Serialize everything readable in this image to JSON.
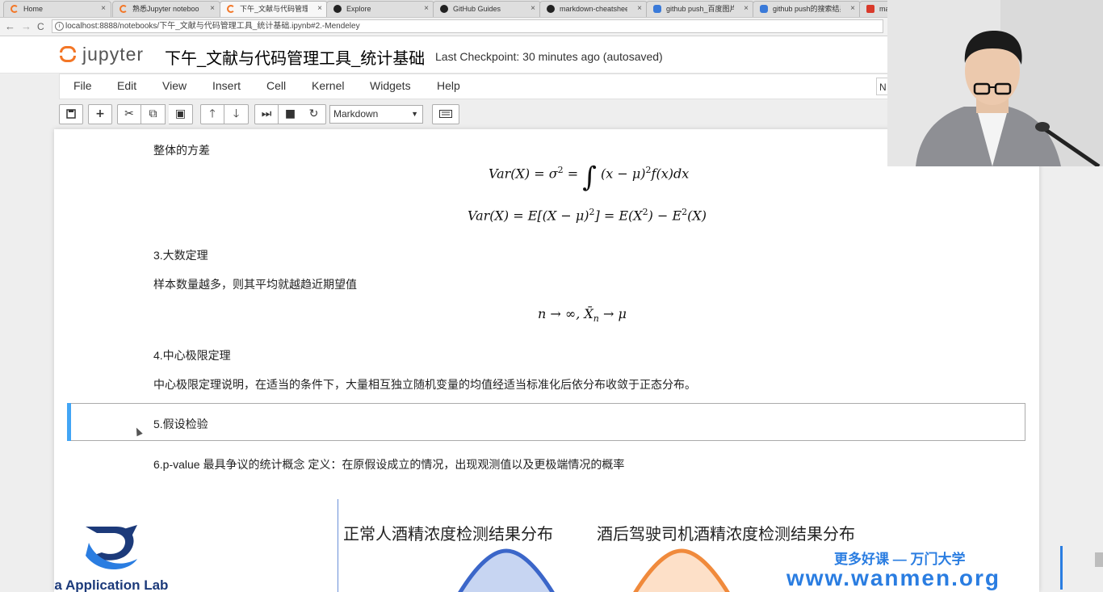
{
  "browser": {
    "tabs": [
      {
        "label": "Home",
        "icon": "jupyter"
      },
      {
        "label": "熟悉Jupyter noteboo",
        "icon": "jupyter"
      },
      {
        "label": "下午_文献与代码管理工",
        "icon": "jupyter",
        "active": true
      },
      {
        "label": "Explore",
        "icon": "github"
      },
      {
        "label": "GitHub Guides",
        "icon": "github"
      },
      {
        "label": "markdown-cheatshee",
        "icon": "github"
      },
      {
        "label": "github push_百度图片",
        "icon": "baidu"
      },
      {
        "label": "github push的搜索结果",
        "icon": "baidu"
      },
      {
        "label": "ma",
        "icon": "red"
      }
    ],
    "close_glyph": "×",
    "back_glyph": "←",
    "forward_glyph": "→",
    "reload_glyph": "C",
    "url": "localhost:8888/notebooks/下午_文献与代码管理工具_统计基础.ipynb#2.-Mendeley"
  },
  "jupyter": {
    "wordmark": "jupyter",
    "notebook_title": "下午_文献与代码管理工具_统计基础",
    "checkpoint": "Last Checkpoint: 30 minutes ago (autosaved)",
    "menu": [
      "File",
      "Edit",
      "View",
      "Insert",
      "Cell",
      "Kernel",
      "Widgets",
      "Help"
    ],
    "kernel_indicator": "N",
    "toolbar": {
      "save_icon": "save-icon",
      "add_icon": "plus-icon",
      "cell_type": "Markdown",
      "cell_type_arrow": "▼"
    }
  },
  "cells": {
    "variance_heading": "整体的方差",
    "var_eq1": {
      "lhs": "Var(X) = σ",
      "sup": "2",
      "mid": " = ",
      "integral": "∫",
      "rhs": " (x − μ)",
      "sup2": "2",
      "rhs2": "f(x)dx"
    },
    "var_eq2": {
      "lhs": "Var(X) = E[(X − μ)",
      "sup": "2",
      "mid": "] = E(X",
      "sup2": "2",
      "mid2": ") − E",
      "sup3": "2",
      "end": "(X)"
    },
    "lln_heading": "3.大数定理",
    "lln_text": "样本数量越多，则其平均就越趋近期望值",
    "lln_eq": {
      "a": "n → ∞, ",
      "xbar": "X̄",
      "sub": "n",
      "b": " → μ"
    },
    "clt_heading": "4.中心极限定理",
    "clt_text": "中心极限定理说明，在适当的条件下，大量相互独立随机变量的均值经适当标准化后依分布收敛于正态分布。",
    "hyp_heading": "5.假设检验",
    "pvalue_text": "6.p-value 最具争议的统计概念 定义：在原假设成立的情况，出现观测值以及更极端情况的概率",
    "chart_left_title": "正常人酒精浓度检测结果分布",
    "chart_right_title": "酒后驾驶司机酒精浓度检测结果分布",
    "lab_name": "Data Application Lab"
  },
  "watermark": {
    "line1": "更多好课 — 万门大学",
    "line2": "www.wanmen.org"
  },
  "colors": {
    "jupyter_orange": "#f37626",
    "selected_bar": "#42a5f5",
    "watermark_blue": "#2a7de1",
    "curve_blue": "#3b66c9",
    "curve_orange": "#f08a3c"
  }
}
